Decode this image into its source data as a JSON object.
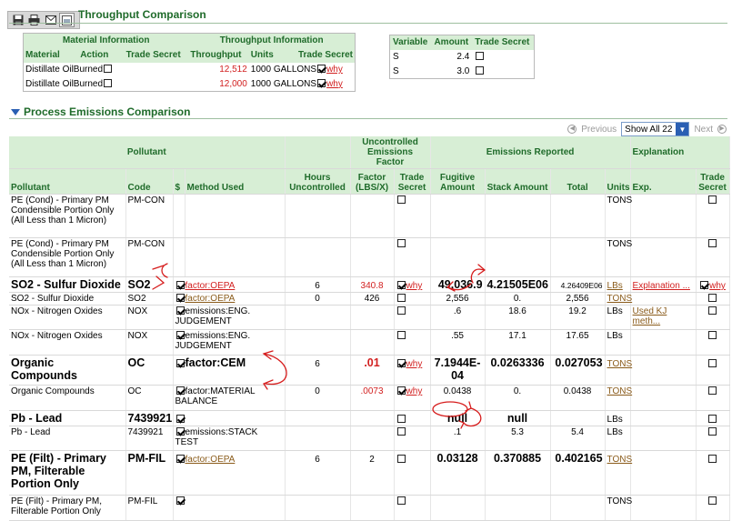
{
  "throughput": {
    "title": "Throughput Comparison",
    "group_material": "Material Information",
    "group_throughput": "Throughput Information",
    "columns": [
      "Material",
      "Action",
      "Trade Secret",
      "Throughput",
      "Units",
      "Trade Secret"
    ],
    "rows": [
      {
        "material": "Distillate Oil",
        "action": "Burned",
        "throughput": "12,512",
        "units": "1000 GALLONS",
        "why": "why"
      },
      {
        "material": "Distillate Oil",
        "action": "Burned",
        "throughput": "12,000",
        "units": "1000 GALLONS",
        "why": "why"
      }
    ]
  },
  "variables": {
    "columns": [
      "Variable",
      "Amount",
      "Trade Secret"
    ],
    "rows": [
      {
        "variable": "S",
        "amount": "2.4"
      },
      {
        "variable": "S",
        "amount": "3.0"
      }
    ]
  },
  "emissions": {
    "title": "Process Emissions Comparison",
    "pager": {
      "previous": "Previous",
      "show": "Show All 22",
      "next": "Next"
    },
    "group_headers": {
      "pollutant": "Pollutant",
      "uncontrolled_ef": "Uncontrolled Emissions Factor",
      "emissions_reported": "Emissions Reported",
      "explanation": "Explanation"
    },
    "columns": {
      "pollutant": "Pollutant",
      "code": "Code",
      "dollar": "$",
      "method": "Method Used",
      "hours": "Hours Uncontrolled",
      "factor": "Factor (LBS/X)",
      "ts": "Trade Secret",
      "fugitive": "Fugitive Amount",
      "stack": "Stack Amount",
      "total": "Total",
      "units": "Units",
      "exp": "Exp.",
      "ts2": "Trade Secret"
    },
    "rows": [
      {
        "pollutant": "PE (Cond) - Primary PM Condensible Portion Only (All Less than 1 Micron)",
        "code": "PM-CON",
        "units": "TONS"
      },
      {
        "pollutant": "PE (Cond) - Primary PM Condensible Portion Only (All Less than 1 Micron)",
        "code": "PM-CON",
        "units": "TONS"
      },
      {
        "pollutant": "SO2 - Sulfur Dioxide",
        "code": "SO2",
        "method": "factor:OEPA",
        "hours": "6",
        "factor": "340.8",
        "why": "why",
        "fugitive": "49,036.9",
        "stack": "4.21505E06",
        "total": "4.26409E06",
        "units": "LBs",
        "exp": "Explanation ...",
        "why2": "why"
      },
      {
        "pollutant": "SO2 - Sulfur Dioxide",
        "code": "SO2",
        "method": "factor:OEPA",
        "hours": "0",
        "factor": "426",
        "fugitive": "2,556",
        "stack": "0.",
        "total": "2,556",
        "units": "TONS"
      },
      {
        "pollutant": "NOx - Nitrogen Oxides",
        "code": "NOX",
        "method": "emissions:ENG. JUDGEMENT",
        "fugitive": ".6",
        "stack": "18.6",
        "total": "19.2",
        "units": "LBs",
        "exp": "Used KJ meth..."
      },
      {
        "pollutant": "NOx - Nitrogen Oxides",
        "code": "NOX",
        "method": "emissions:ENG. JUDGEMENT",
        "fugitive": ".55",
        "stack": "17.1",
        "total": "17.65",
        "units": "LBs"
      },
      {
        "pollutant": "Organic Compounds",
        "code": "OC",
        "method": "factor:CEM",
        "hours": "6",
        "factor": ".01",
        "why": "why",
        "fugitive": "7.1944E-04",
        "stack": "0.0263336",
        "total": "0.027053",
        "units": "TONS"
      },
      {
        "pollutant": "Organic Compounds",
        "code": "OC",
        "method": "factor:MATERIAL BALANCE",
        "hours": "0",
        "factor": ".0073",
        "why": "why",
        "fugitive": "0.0438",
        "stack": "0.",
        "total": "0.0438",
        "units": "TONS"
      },
      {
        "pollutant": "Pb - Lead",
        "code": "7439921",
        "fugitive": "null",
        "stack": "null",
        "units": "LBs"
      },
      {
        "pollutant": "Pb - Lead",
        "code": "7439921",
        "method": "emissions:STACK TEST",
        "fugitive": ".1",
        "stack": "5.3",
        "total": "5.4",
        "units": "LBs"
      },
      {
        "pollutant": "PE (Filt) - Primary PM, Filterable Portion Only",
        "code": "PM-FIL",
        "method": "factor:OEPA",
        "hours": "6",
        "factor": "2",
        "fugitive": "0.03128",
        "stack": "0.370885",
        "total": "0.402165",
        "units": "TONS"
      },
      {
        "pollutant": "PE (Filt) - Primary PM, Filterable Portion Only",
        "code": "PM-FIL",
        "units": "TONS"
      }
    ]
  },
  "colors": {
    "header_bg": "#d7eed5",
    "header_text": "#1f6b2a",
    "accent_red": "#d22020",
    "link_brown": "#8a5b1a",
    "annotation_red": "#d61c1c"
  }
}
